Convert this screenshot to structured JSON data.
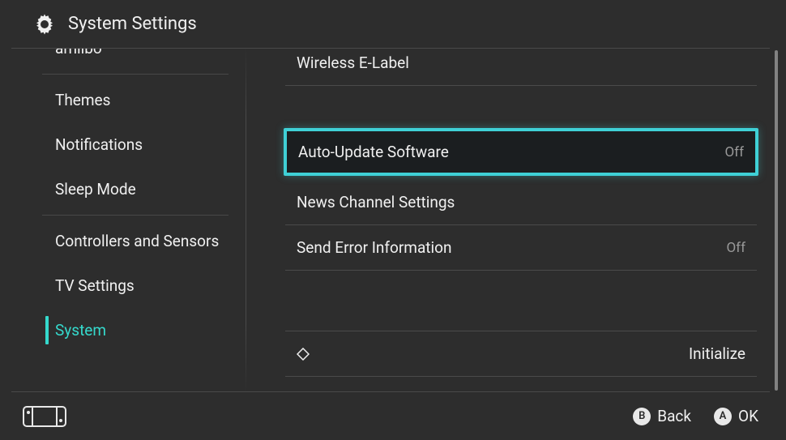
{
  "header": {
    "title": "System Settings"
  },
  "sidebar": [
    {
      "label": "amiibo",
      "active": false,
      "divider_after": true
    },
    {
      "label": "Themes",
      "active": false
    },
    {
      "label": "Notifications",
      "active": false
    },
    {
      "label": "Sleep Mode",
      "active": false,
      "divider_after": true
    },
    {
      "label": "Controllers and Sensors",
      "active": false
    },
    {
      "label": "TV Settings",
      "active": false
    },
    {
      "label": "System",
      "active": true
    }
  ],
  "settings": {
    "wireless_elabel": {
      "label": "Wireless E-Label"
    },
    "auto_update": {
      "label": "Auto-Update Software",
      "value": "Off",
      "highlighted": true
    },
    "news_channel": {
      "label": "News Channel Settings"
    },
    "send_error": {
      "label": "Send Error Information",
      "value": "Off"
    },
    "initialize": {
      "label": "Initialize"
    }
  },
  "footer": {
    "back_letter": "B",
    "back_label": "Back",
    "ok_letter": "A",
    "ok_label": "OK"
  }
}
